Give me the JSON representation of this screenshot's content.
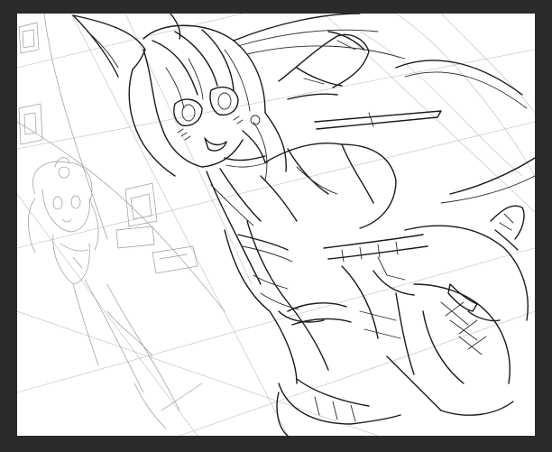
{
  "app": {
    "background_color": "#2b2b2b",
    "canvas_color": "#ffffff"
  },
  "artwork": {
    "line_color": "#1a1a1a",
    "sketch_color": "#9a9a9a"
  }
}
